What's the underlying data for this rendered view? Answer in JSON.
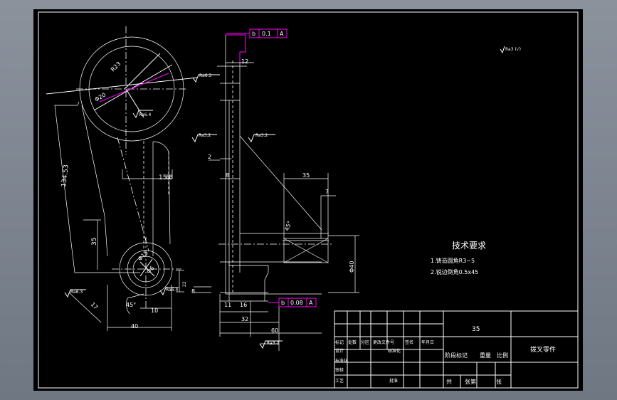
{
  "drawing": {
    "tech_req": {
      "title": "技术要求",
      "items": [
        "1.铸造圆角R3~5",
        "2.锐边倒角0.5x45"
      ]
    },
    "roughness_general": "Ra3 (√)",
    "roughness_labels": [
      "Ra6.3",
      "Ra6.4",
      "Ra3.2",
      "Ra3.2",
      "Ra6.3",
      "Ra6.4",
      "Ra3.2"
    ],
    "tolerance_frames": [
      {
        "symbol": "b",
        "value": "0.1",
        "datum": "A"
      },
      {
        "symbol": "b",
        "value": "0.08",
        "datum": "A"
      }
    ],
    "dims": {
      "d1": "12",
      "d2": "2",
      "d3": "8",
      "d4": "15.8",
      "d5": "8",
      "d6": "134.53",
      "d7": "35",
      "d8": "R23",
      "d9": "Φ15",
      "d10": "Φ20",
      "d11": "Φ6",
      "d12": "17",
      "d13": "45°",
      "d14": "10",
      "d15": "40",
      "d16": "22",
      "d17": "8",
      "d18": "11",
      "d19": "16",
      "d20": "32",
      "d21": "60",
      "d22": "35",
      "d23": "7",
      "d24": "45°",
      "d25": "Φ40"
    },
    "title_block": {
      "material": "35",
      "part_name": "拨叉零件",
      "stage_label": "阶段标记",
      "weight_label": "重量",
      "scale_label": "比例",
      "total_label": "共",
      "sheets_label": "张第",
      "sheet_label": "张",
      "rev_headers": [
        "标记",
        "处数",
        "分区",
        "更改文件号",
        "签名",
        "年月日"
      ],
      "role_rows": [
        "设计",
        "标准化",
        "审核",
        "工艺",
        "批准"
      ],
      "role_cols": [
        "标准化",
        "批准"
      ]
    }
  }
}
